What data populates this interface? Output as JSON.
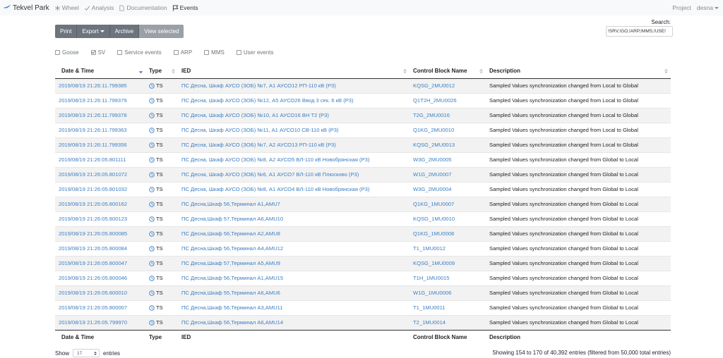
{
  "navbar": {
    "brand": "Tekvel Park",
    "items": [
      {
        "label": "Wheel",
        "icon": "asterisk-icon",
        "active": false
      },
      {
        "label": "Analysis",
        "icon": "check-icon",
        "active": false
      },
      {
        "label": "Documentation",
        "icon": "file-icon",
        "active": false
      },
      {
        "label": "Events",
        "icon": "flag-icon",
        "active": true
      }
    ],
    "project_label": "Project",
    "user_label": "desna"
  },
  "toolbar": {
    "print_label": "Print",
    "export_label": "Export",
    "archive_label": "Archive",
    "view_selected_label": "View selected"
  },
  "search": {
    "label": "Search:",
    "value": "!SRV,!GO,!ARP,!MMS,!USE!"
  },
  "filters": [
    {
      "label": "Goose",
      "checked": false
    },
    {
      "label": "SV",
      "checked": true
    },
    {
      "label": "Service events",
      "checked": false
    },
    {
      "label": "ARP",
      "checked": false
    },
    {
      "label": "MMS",
      "checked": false
    },
    {
      "label": "User events",
      "checked": false
    }
  ],
  "table": {
    "columns": [
      "Date & Time",
      "Type",
      "IED",
      "Control Block Name",
      "Description"
    ],
    "rows": [
      {
        "datetime": "2019/08/19 21:26:11.799385",
        "type": "TS",
        "ied": "ПС Десна, Шкаф АУСО (ЗОБ) №7, А1 АУСО12 РП-110 кВ (Р3)",
        "cb": "KQSG_2MU0012",
        "desc": "Sampled Values synchronization changed from Local to Global"
      },
      {
        "datetime": "2019/08/19 21:26:11.799379",
        "type": "TS",
        "ied": "ПС Десна, Шкаф АУСО (ЗОБ) №12, А5 АУСО26 Ввод 3 сек. 6 кВ (Р3)",
        "cb": "Q1T2H_2MU0026",
        "desc": "Sampled Values synchronization changed from Local to Global"
      },
      {
        "datetime": "2019/08/19 21:26:11.799378",
        "type": "TS",
        "ied": "ПС Десна, Шкаф АУСО (ЗОБ) №10, А1 АУСО16 ВН Т2 (Р3)",
        "cb": "T2G_2MU0016",
        "desc": "Sampled Values synchronization changed from Local to Global"
      },
      {
        "datetime": "2019/08/19 21:26:11.799363",
        "type": "TS",
        "ied": "ПС Десна, Шкаф АУСО (ЗОБ) №11, А1 АУСО10 СВ-110 кВ (Р3)",
        "cb": "Q1KG_2MU0010",
        "desc": "Sampled Values synchronization changed from Local to Global"
      },
      {
        "datetime": "2019/08/19 21:26:11.799356",
        "type": "TS",
        "ied": "ПС Десна, Шкаф АУСО (ЗОБ) №7, А2 АУСО13 РП-110 кВ (Р3)",
        "cb": "KQSG_2MU0013",
        "desc": "Sampled Values synchronization changed from Local to Global"
      },
      {
        "datetime": "2019/08/19 21:26:05.801111",
        "type": "TS",
        "ied": "ПС Десна, Шкаф АУСО (ЗОБ) №8, А2 АУСО5 ВЛ-110 кВ Новобрянская (Р3)",
        "cb": "W3G_2MU0005",
        "desc": "Sampled Values synchronization changed from Global to Local"
      },
      {
        "datetime": "2019/08/19 21:26:05.801072",
        "type": "TS",
        "ied": "ПС Десна, Шкаф АУСО (ЗОБ) №6, А1 АУСО7 ВЛ-110 кВ Плюсково (Р3)",
        "cb": "W1G_2MU0007",
        "desc": "Sampled Values synchronization changed from Global to Local"
      },
      {
        "datetime": "2019/08/19 21:26:05.801032",
        "type": "TS",
        "ied": "ПС Десна, Шкаф АУСО (ЗОБ) №8, А1 АУСО4 ВЛ-110 кВ Новобрянская (Р3)",
        "cb": "W3G_2MU0004",
        "desc": "Sampled Values synchronization changed from Global to Local"
      },
      {
        "datetime": "2019/08/19 21:26:05.800162",
        "type": "TS",
        "ied": "ПС Десна,Шкаф 56,Терминал А1,AMU7",
        "cb": "Q1KG_1MU0007",
        "desc": "Sampled Values synchronization changed from Global to Local"
      },
      {
        "datetime": "2019/08/19 21:26:05.800123",
        "type": "TS",
        "ied": "ПС Десна,Шкаф 57,Терминал А6,AMU10",
        "cb": "KQSG_1MU0010",
        "desc": "Sampled Values synchronization changed from Global to Local"
      },
      {
        "datetime": "2019/08/19 21:26:05.800085",
        "type": "TS",
        "ied": "ПС Десна,Шкаф 56,Терминал А2,AMU8",
        "cb": "Q1KG_1MU0008",
        "desc": "Sampled Values synchronization changed from Global to Local"
      },
      {
        "datetime": "2019/08/19 21:26:05.800084",
        "type": "TS",
        "ied": "ПС Десна,Шкаф 56,Терминал А4,AMU12",
        "cb": "T1_1MU0012",
        "desc": "Sampled Values synchronization changed from Global to Local"
      },
      {
        "datetime": "2019/08/19 21:26:05.800047",
        "type": "TS",
        "ied": "ПС Десна,Шкаф 57,Терминал А5,AMU9",
        "cb": "KQSG_1MU0009",
        "desc": "Sampled Values synchronization changed from Global to Local"
      },
      {
        "datetime": "2019/08/19 21:26:05.800046",
        "type": "TS",
        "ied": "ПС Десна,Шкаф 56,Терминал А1,AMU15",
        "cb": "T1H_1MU0015",
        "desc": "Sampled Values synchronization changed from Global to Local"
      },
      {
        "datetime": "2019/08/19 21:26:05.800010",
        "type": "TS",
        "ied": "ПС Десна,Шкаф 55,Терминал А6,AMU6",
        "cb": "W1G_1MU0006",
        "desc": "Sampled Values synchronization changed from Global to Local"
      },
      {
        "datetime": "2019/08/19 21:26:05.800007",
        "type": "TS",
        "ied": "ПС Десна,Шкаф 56,Терминал А3,AMU11",
        "cb": "T1_1MU0011",
        "desc": "Sampled Values synchronization changed from Global to Local"
      },
      {
        "datetime": "2019/08/19 21:26:05.799970",
        "type": "TS",
        "ied": "ПС Десна,Шкаф 56,Терминал А6,AMU14",
        "cb": "T2_1MU0014",
        "desc": "Sampled Values synchronization changed from Global to Local"
      }
    ]
  },
  "paging": {
    "show_label": "Show",
    "page_size": "17",
    "entries_label": "entries",
    "info": "Showing 154 to 170 of 40,392 entries (filtered from 50,000 total entries)"
  },
  "colors": {
    "link": "#3b7ec3",
    "toolbar": "#6c757d",
    "toolbar_active": "#9aa0a6",
    "navbar_bg": "#f8f9fa",
    "row_stripe": "#f2f2f2"
  }
}
